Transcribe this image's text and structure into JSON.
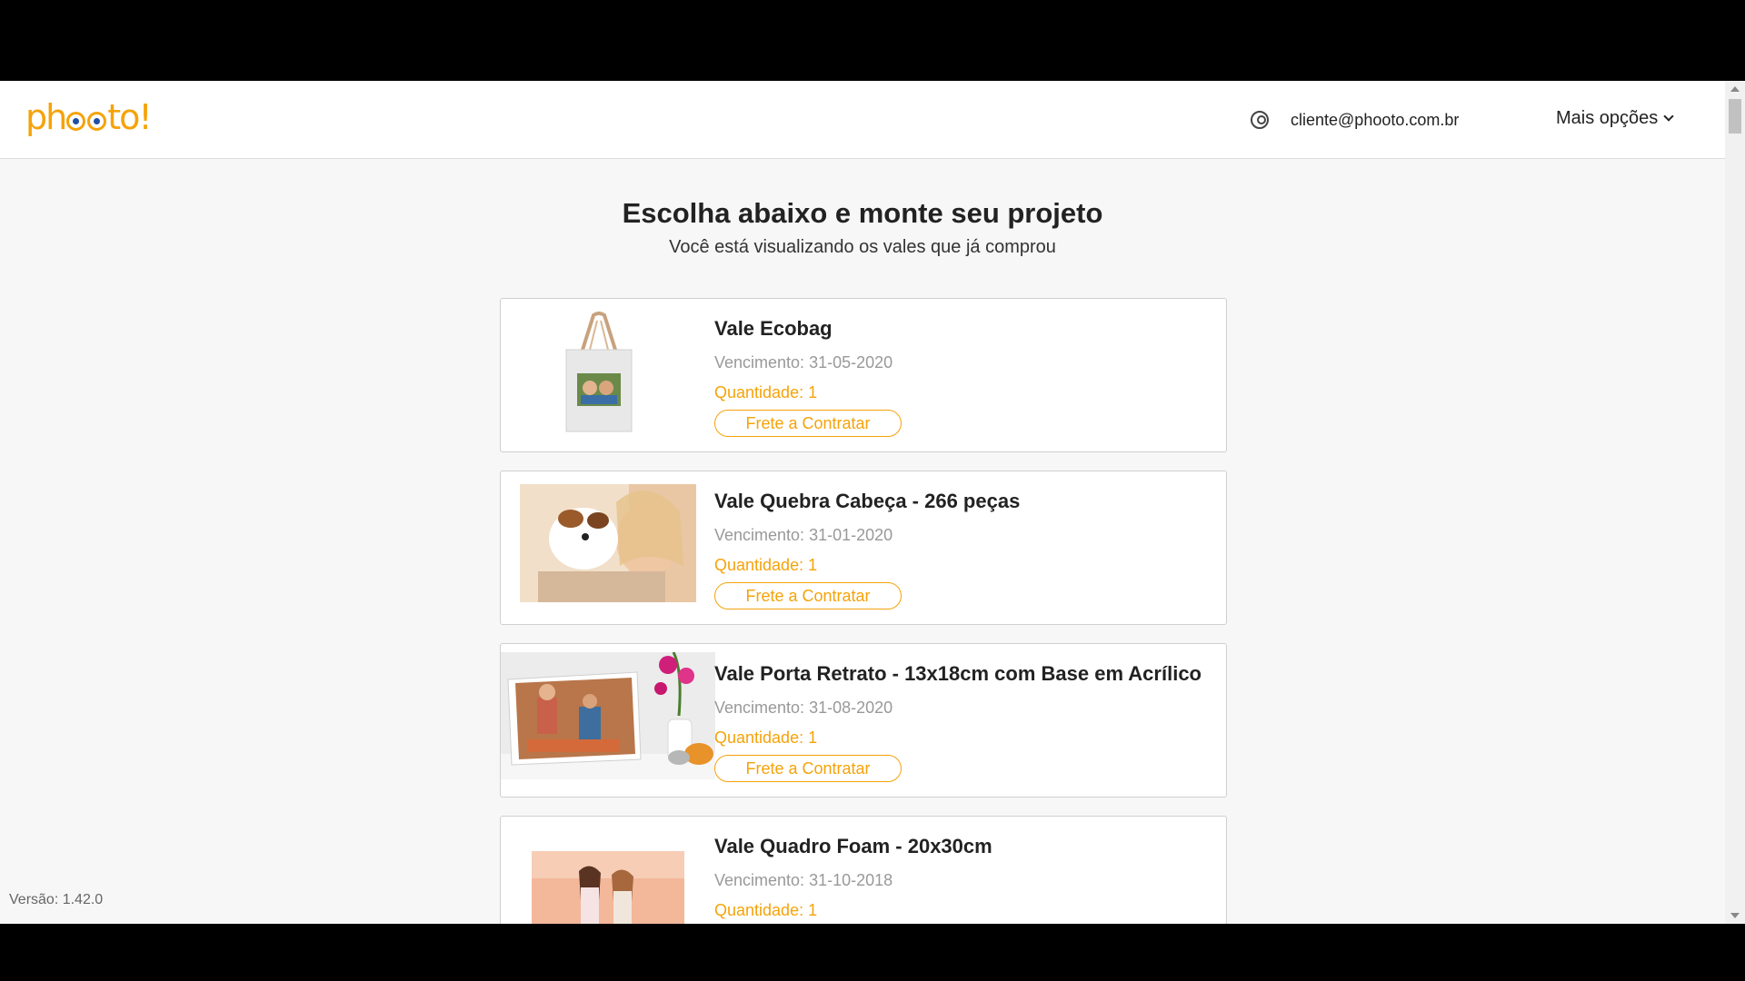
{
  "header": {
    "logo_text": "phooto!",
    "user_email": "cliente@phooto.com.br",
    "more_options_label": "Mais opções"
  },
  "main": {
    "title": "Escolha abaixo e monte seu projeto",
    "subtitle": "Você está visualizando os vales que já comprou"
  },
  "vouchers": [
    {
      "name": "Vale Ecobag",
      "due": "Vencimento: 31-05-2020",
      "qty": "Quantidade: 1",
      "freight": "Frete a Contratar"
    },
    {
      "name": "Vale Quebra Cabeça - 266 peças",
      "due": "Vencimento: 31-01-2020",
      "qty": "Quantidade: 1",
      "freight": "Frete a Contratar"
    },
    {
      "name": "Vale Porta Retrato - 13x18cm com Base em Acrílico",
      "due": "Vencimento: 31-08-2020",
      "qty": "Quantidade: 1",
      "freight": "Frete a Contratar"
    },
    {
      "name": "Vale Quadro Foam - 20x30cm",
      "due": "Vencimento: 31-10-2018",
      "qty": "Quantidade: 1"
    }
  ],
  "footer": {
    "version": "Versão: 1.42.0"
  },
  "colors": {
    "accent": "#f5a30a",
    "logo_pupil": "#1f4fa3",
    "muted": "#999999"
  }
}
